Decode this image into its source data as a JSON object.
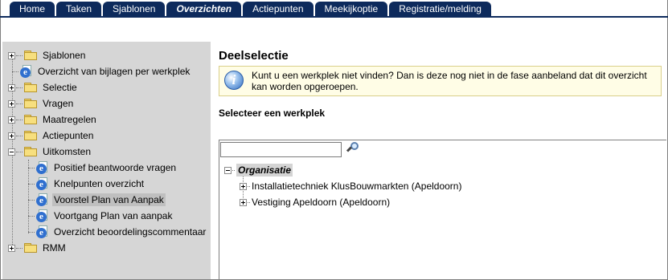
{
  "tabs": [
    {
      "label": "Home",
      "active": false
    },
    {
      "label": "Taken",
      "active": false
    },
    {
      "label": "Sjablonen",
      "active": false
    },
    {
      "label": "Overzichten",
      "active": true
    },
    {
      "label": "Actiepunten",
      "active": false
    },
    {
      "label": "Meekijkoptie",
      "active": false
    },
    {
      "label": "Registratie/melding",
      "active": false
    }
  ],
  "sidebar": {
    "items": [
      {
        "label": "Sjablonen",
        "type": "folder",
        "expander": "plus"
      },
      {
        "label": "Overzicht van bijlagen per werkplek",
        "type": "page",
        "expander": "none"
      },
      {
        "label": "Selectie",
        "type": "folder",
        "expander": "plus"
      },
      {
        "label": "Vragen",
        "type": "folder",
        "expander": "plus"
      },
      {
        "label": "Maatregelen",
        "type": "folder",
        "expander": "plus"
      },
      {
        "label": "Actiepunten",
        "type": "folder",
        "expander": "plus"
      },
      {
        "label": "Uitkomsten",
        "type": "folder",
        "expander": "minus"
      },
      {
        "label": "Positief beantwoorde vragen",
        "type": "page",
        "child": true
      },
      {
        "label": "Knelpunten overzicht",
        "type": "page",
        "child": true
      },
      {
        "label": "Voorstel Plan van Aanpak",
        "type": "page",
        "child": true,
        "selected": true
      },
      {
        "label": "Voortgang Plan van aanpak",
        "type": "page",
        "child": true
      },
      {
        "label": "Overzicht beoordelingscommentaar",
        "type": "page",
        "child": true
      },
      {
        "label": "RMM",
        "type": "folder",
        "expander": "plus"
      }
    ]
  },
  "main": {
    "heading": "Deelselectie",
    "info_text": "Kunt u een werkplek niet vinden? Dan is deze nog niet in de fase aanbeland dat dit overzicht kan worden opgeroepen.",
    "select_label": "Selecteer een werkplek",
    "search": {
      "value": "",
      "placeholder": ""
    },
    "tree": {
      "root": "Organisatie",
      "children": [
        "Installatietechniek KlusBouwmarkten (Apeldoorn)",
        "Vestiging Apeldoorn (Apeldoorn)"
      ]
    }
  },
  "colors": {
    "tab_bg": "#0d2a5c",
    "sidebar_bg": "#d6d6d6",
    "info_bg": "#fffde6"
  }
}
